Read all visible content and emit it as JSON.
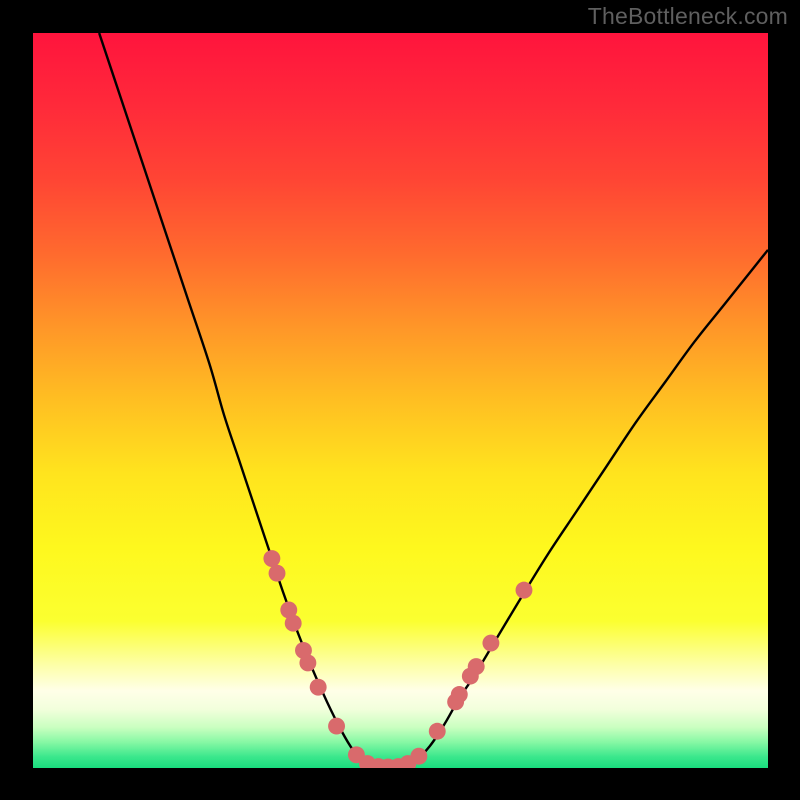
{
  "watermark": "TheBottleneck.com",
  "colors": {
    "frame": "#000000",
    "watermark": "#5f5f5f",
    "curve": "#000000",
    "marker_fill": "#d96a6c",
    "marker_stroke": "#d96a6c"
  },
  "gradient": {
    "stops": [
      {
        "offset": 0.0,
        "color": "#ff143d"
      },
      {
        "offset": 0.1,
        "color": "#ff2a3a"
      },
      {
        "offset": 0.2,
        "color": "#ff4534"
      },
      {
        "offset": 0.3,
        "color": "#ff6a2e"
      },
      {
        "offset": 0.4,
        "color": "#ff9628"
      },
      {
        "offset": 0.5,
        "color": "#ffbf22"
      },
      {
        "offset": 0.6,
        "color": "#ffe41e"
      },
      {
        "offset": 0.7,
        "color": "#fef81e"
      },
      {
        "offset": 0.8,
        "color": "#fbff30"
      },
      {
        "offset": 0.86,
        "color": "#fdffa8"
      },
      {
        "offset": 0.895,
        "color": "#ffffe8"
      },
      {
        "offset": 0.92,
        "color": "#f2ffdc"
      },
      {
        "offset": 0.945,
        "color": "#c9ffc0"
      },
      {
        "offset": 0.965,
        "color": "#86f8a4"
      },
      {
        "offset": 0.985,
        "color": "#3ae78c"
      },
      {
        "offset": 1.0,
        "color": "#19dd7e"
      }
    ]
  },
  "chart_data": {
    "type": "line",
    "title": "",
    "xlabel": "",
    "ylabel": "",
    "xlim": [
      0,
      100
    ],
    "ylim": [
      0,
      100
    ],
    "series": [
      {
        "name": "left-curve",
        "x": [
          9,
          12,
          15,
          18,
          21,
          24,
          26,
          28,
          30,
          32,
          34,
          36,
          38,
          40,
          42,
          43.5,
          45,
          46
        ],
        "y": [
          100,
          91,
          82,
          73,
          64,
          55,
          48,
          42,
          36,
          30,
          24,
          18.5,
          13.5,
          9,
          5,
          2.5,
          0.8,
          0.2
        ]
      },
      {
        "name": "right-curve",
        "x": [
          50,
          52,
          54,
          56,
          58,
          60,
          63,
          66,
          70,
          74,
          78,
          82,
          86,
          90,
          94,
          98,
          100
        ],
        "y": [
          0.2,
          1.0,
          3.0,
          6.0,
          9.5,
          12.5,
          17.5,
          22.5,
          29,
          35,
          41,
          47,
          52.5,
          58,
          63,
          68,
          70.5
        ]
      },
      {
        "name": "bottom-flat",
        "x": [
          46,
          48,
          50
        ],
        "y": [
          0.15,
          0.1,
          0.15
        ]
      }
    ],
    "markers": [
      {
        "x": 32.5,
        "y": 28.5
      },
      {
        "x": 33.2,
        "y": 26.5
      },
      {
        "x": 34.8,
        "y": 21.5
      },
      {
        "x": 35.4,
        "y": 19.7
      },
      {
        "x": 36.8,
        "y": 16.0
      },
      {
        "x": 37.4,
        "y": 14.3
      },
      {
        "x": 38.8,
        "y": 11.0
      },
      {
        "x": 41.3,
        "y": 5.7
      },
      {
        "x": 44.0,
        "y": 1.8
      },
      {
        "x": 45.5,
        "y": 0.6
      },
      {
        "x": 47.0,
        "y": 0.2
      },
      {
        "x": 48.3,
        "y": 0.15
      },
      {
        "x": 49.7,
        "y": 0.2
      },
      {
        "x": 51.0,
        "y": 0.6
      },
      {
        "x": 52.5,
        "y": 1.6
      },
      {
        "x": 55.0,
        "y": 5.0
      },
      {
        "x": 57.5,
        "y": 9.0
      },
      {
        "x": 58.0,
        "y": 10.0
      },
      {
        "x": 59.5,
        "y": 12.5
      },
      {
        "x": 60.3,
        "y": 13.8
      },
      {
        "x": 62.3,
        "y": 17.0
      },
      {
        "x": 66.8,
        "y": 24.2
      }
    ],
    "marker_radius": 1.15
  }
}
